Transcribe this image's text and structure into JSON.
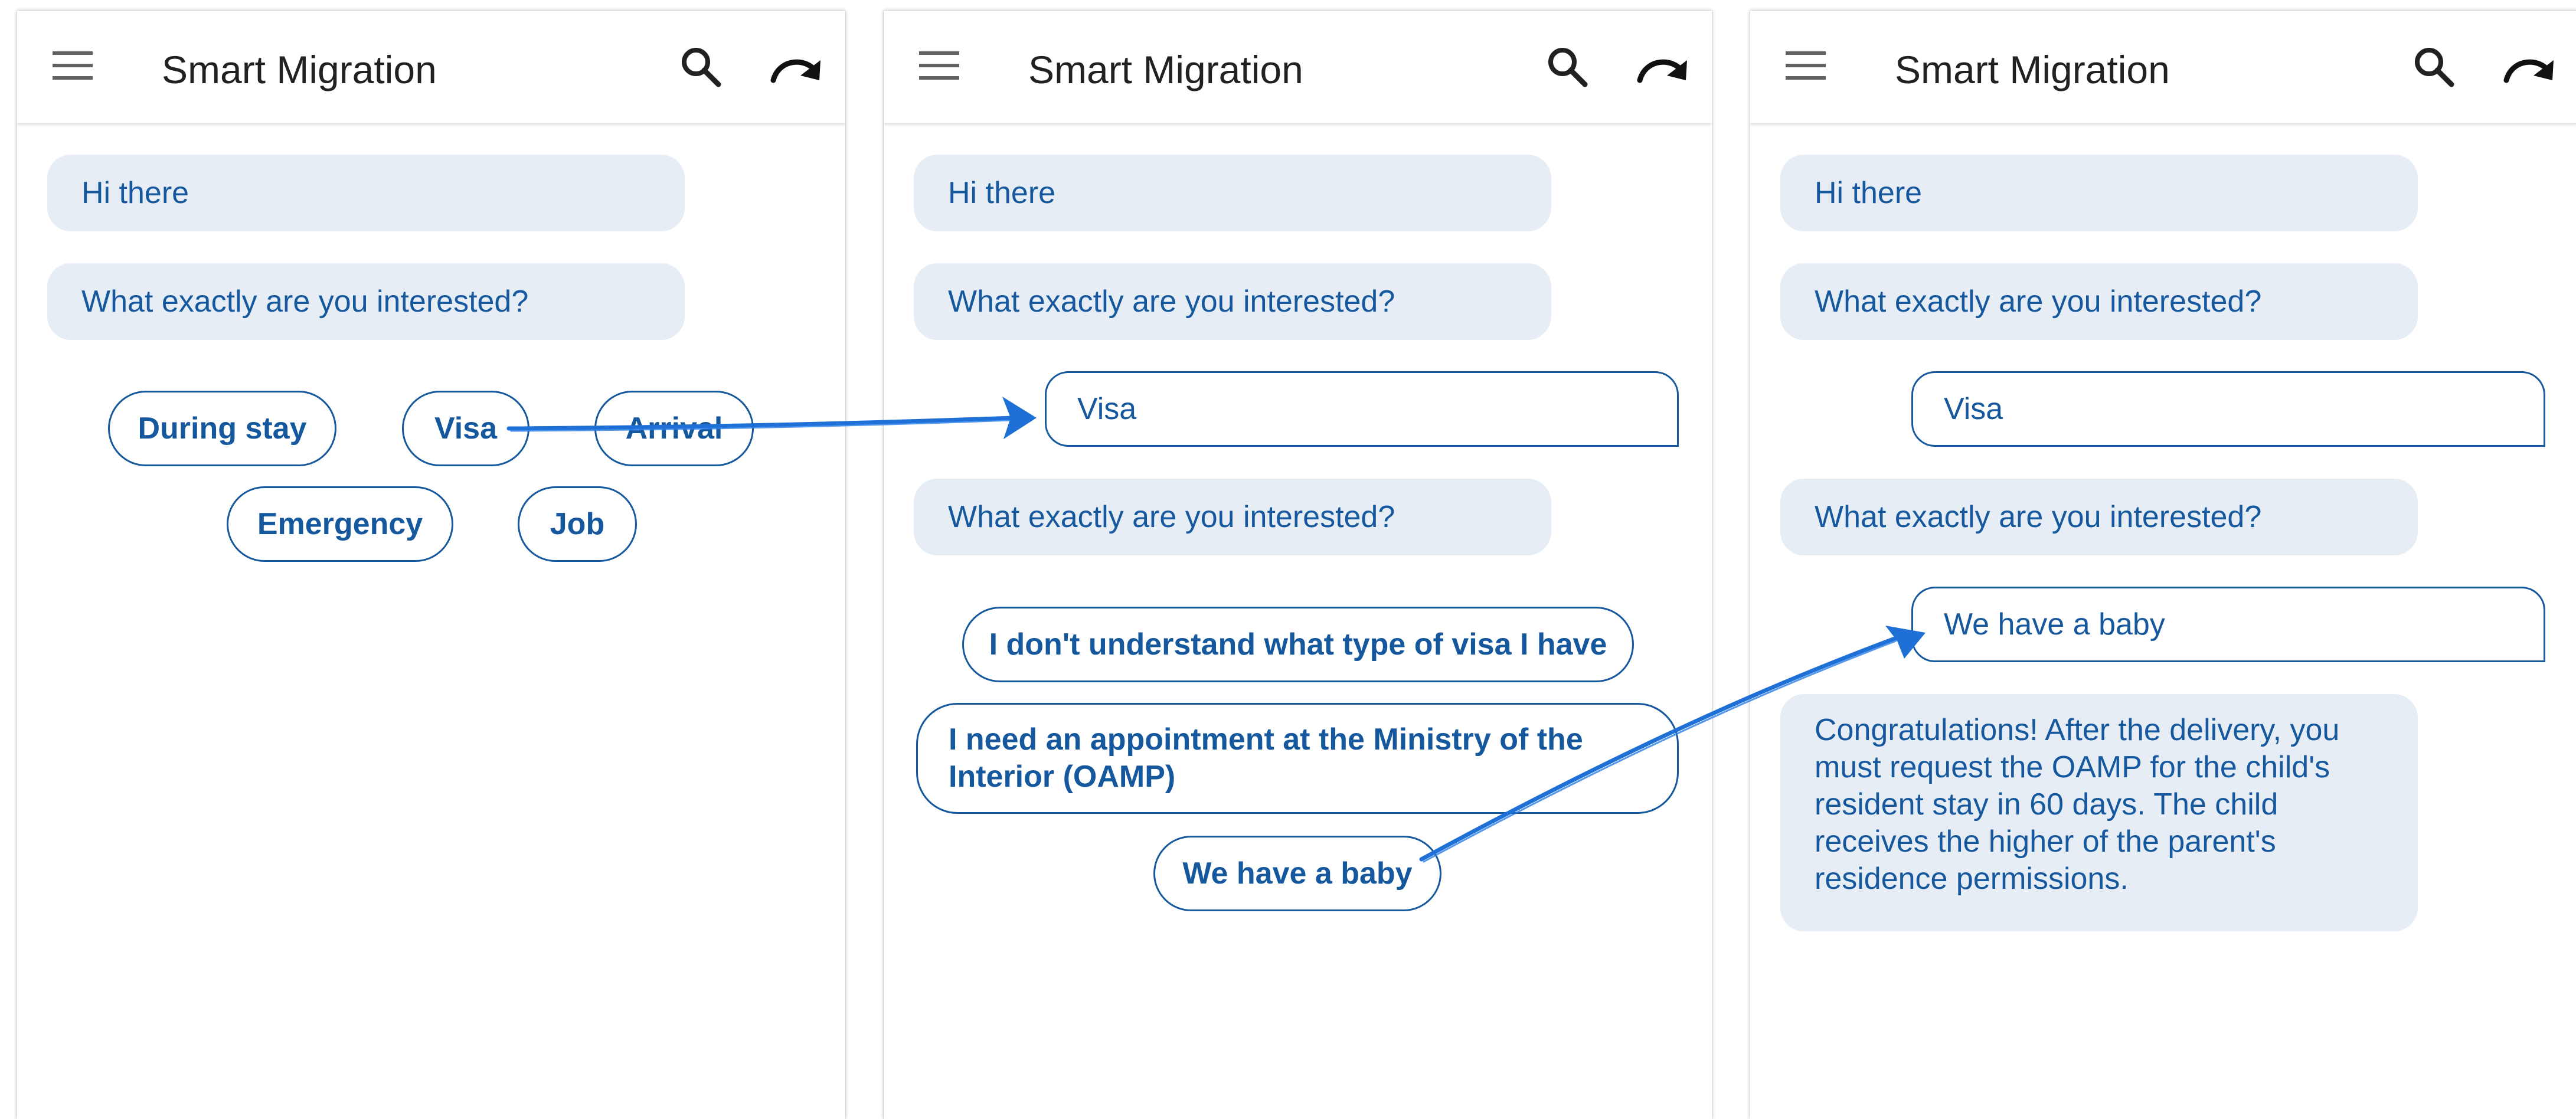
{
  "app": {
    "title": "Smart Migration"
  },
  "icons": {
    "menu": "menu-icon",
    "search": "search-icon",
    "redo": "redo-icon"
  },
  "colors": {
    "accent": "#15589e",
    "bot_bubble": "#e7edf5",
    "arrow": "#1e6fd6",
    "title_text": "#212121"
  },
  "messages": {
    "greeting": "Hi there",
    "question": "What exactly are you interested?",
    "user_visa": "Visa",
    "user_baby": "We have a baby",
    "answer_baby": "Congratulations! After the delivery, you must request the OAMP for the child's resident stay in 60 days. The child receives the higher of the parent's residence permissions."
  },
  "screen1": {
    "chips": [
      "During stay",
      "Visa",
      "Arrival",
      "Emergency",
      "Job"
    ]
  },
  "screen2": {
    "chips": [
      "I don't understand what type of visa I have",
      "I need an appointment at the Ministry of the Interior (OAMP)",
      "We have a baby"
    ]
  }
}
